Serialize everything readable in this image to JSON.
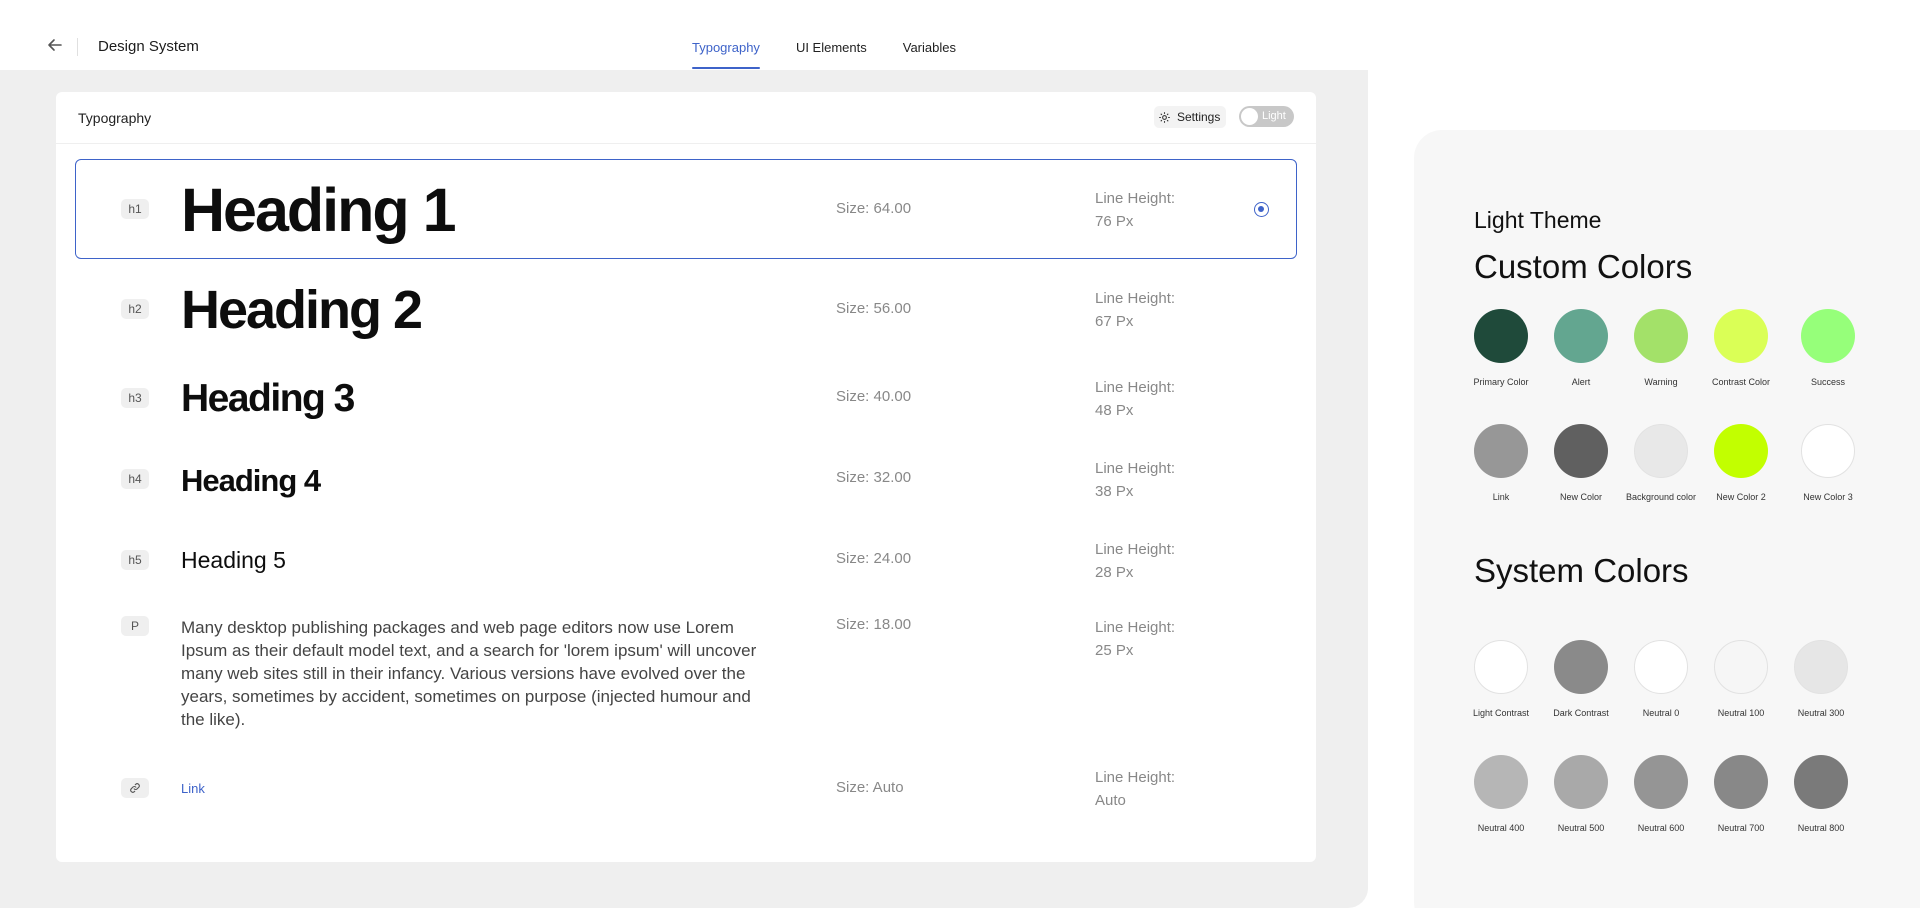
{
  "header": {
    "title": "Design System",
    "tabs": [
      {
        "label": "Typography",
        "active": true
      },
      {
        "label": "UI Elements",
        "active": false
      },
      {
        "label": "Variables",
        "active": false
      }
    ]
  },
  "panel": {
    "title": "Typography",
    "settings_label": "Settings",
    "toggle_label": "Light",
    "rows": [
      {
        "tag": "h1",
        "sample": "Heading 1",
        "size": "Size: 64.00",
        "lh_label": "Line Height:",
        "lh_value": "76 Px",
        "selected": true
      },
      {
        "tag": "h2",
        "sample": "Heading 2",
        "size": "Size: 56.00",
        "lh_label": "Line Height:",
        "lh_value": "67 Px"
      },
      {
        "tag": "h3",
        "sample": "Heading 3",
        "size": "Size: 40.00",
        "lh_label": "Line Height:",
        "lh_value": "48 Px"
      },
      {
        "tag": "h4",
        "sample": "Heading 4",
        "size": "Size: 32.00",
        "lh_label": "Line Height:",
        "lh_value": "38 Px"
      },
      {
        "tag": "h5",
        "sample": "Heading 5",
        "size": "Size: 24.00",
        "lh_label": "Line Height:",
        "lh_value": "28 Px"
      },
      {
        "tag": "P",
        "sample": "Many desktop publishing packages and web page editors now use Lorem Ipsum as their default model text, and a search for 'lorem ipsum' will uncover many web sites still in their infancy. Various versions have evolved over the years, sometimes by accident, sometimes on purpose (injected humour and the like).",
        "size": "Size: 18.00",
        "lh_label": "Line Height:",
        "lh_value": "25 Px"
      },
      {
        "tag_icon": "link-icon",
        "sample": "Link",
        "size": "Size: Auto",
        "lh_label": "Line Height:",
        "lh_value": "Auto"
      }
    ]
  },
  "theme": {
    "label": "Light Theme",
    "custom_heading": "Custom Colors",
    "system_heading": "System Colors",
    "custom_colors": [
      {
        "name": "Primary Color",
        "color": "#1f4a3a"
      },
      {
        "name": "Alert",
        "color": "#63a690"
      },
      {
        "name": "Warning",
        "color": "#a3e169"
      },
      {
        "name": "Contrast Color",
        "color": "#daff56"
      },
      {
        "name": "Success",
        "color": "#96ff7a"
      },
      {
        "name": "Link",
        "color": "#979797"
      },
      {
        "name": "New Color",
        "color": "#606060"
      },
      {
        "name": "Background color",
        "color": "#e8e8e8"
      },
      {
        "name": "New Color 2",
        "color": "#c2ff00"
      },
      {
        "name": "New Color 3",
        "color": "#ffffff"
      }
    ],
    "system_colors": [
      {
        "name": "Light Contrast",
        "color": "#ffffff"
      },
      {
        "name": "Dark Contrast",
        "color": "#8a8a8a"
      },
      {
        "name": "Neutral 0",
        "color": "#ffffff"
      },
      {
        "name": "Neutral 100",
        "color": "#f6f6f6"
      },
      {
        "name": "Neutral 300",
        "color": "#e6e6e6"
      },
      {
        "name": "Neutral 400",
        "color": "#b6b6b6"
      },
      {
        "name": "Neutral 500",
        "color": "#a9a9a9"
      },
      {
        "name": "Neutral 600",
        "color": "#959595"
      },
      {
        "name": "Neutral 700",
        "color": "#888888"
      },
      {
        "name": "Neutral 800",
        "color": "#7a7a7a"
      }
    ]
  }
}
